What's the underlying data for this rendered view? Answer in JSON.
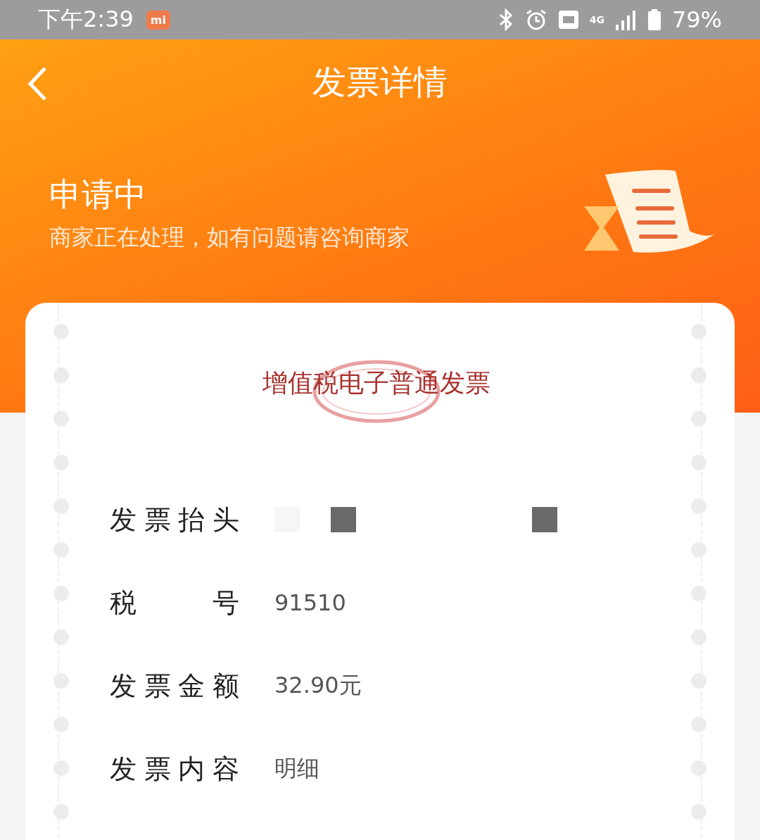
{
  "status_bar": {
    "time": "下午2:39",
    "app_badge": "mi",
    "network": "4G",
    "battery": "79%"
  },
  "header": {
    "title": "发票详情"
  },
  "status": {
    "title": "申请中",
    "message": "商家正在处理，如有问题请咨询商家"
  },
  "invoice": {
    "type": "增值税电子普通发票",
    "fields": [
      {
        "kind": "redacted",
        "label": "发票抬头"
      },
      {
        "kind": "text",
        "label": "税号",
        "value": "91510"
      },
      {
        "kind": "text",
        "label": "发票金额",
        "value": "32.90元"
      },
      {
        "kind": "text",
        "label": "发票内容",
        "value": "明细"
      }
    ]
  }
}
